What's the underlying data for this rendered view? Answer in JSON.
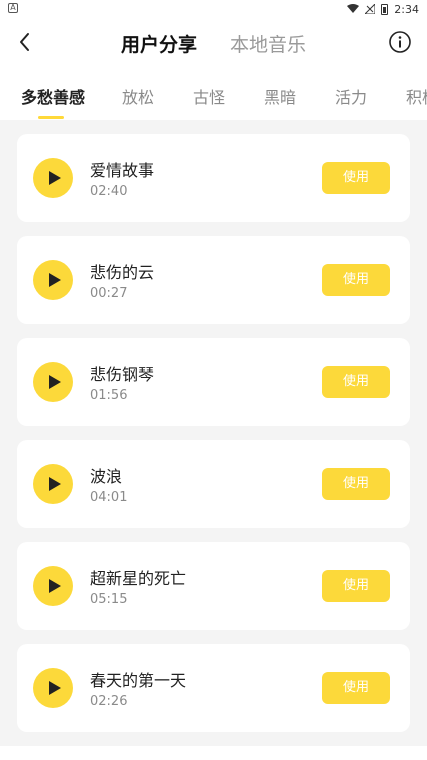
{
  "status": {
    "time": "2:34",
    "left_icon": "A"
  },
  "nav": {
    "tabs": [
      "用户分享",
      "本地音乐"
    ],
    "active_tab": 0
  },
  "categories": {
    "items": [
      "多愁善感",
      "放松",
      "古怪",
      "黑暗",
      "活力",
      "积极"
    ],
    "active": 0
  },
  "tracks": [
    {
      "title": "爱情故事",
      "duration": "02:40",
      "action": "使用"
    },
    {
      "title": "悲伤的云",
      "duration": "00:27",
      "action": "使用"
    },
    {
      "title": "悲伤钢琴",
      "duration": "01:56",
      "action": "使用"
    },
    {
      "title": "波浪",
      "duration": "04:01",
      "action": "使用"
    },
    {
      "title": "超新星的死亡",
      "duration": "05:15",
      "action": "使用"
    },
    {
      "title": "春天的第一天",
      "duration": "02:26",
      "action": "使用"
    }
  ],
  "colors": {
    "accent": "#fcd93a",
    "background": "#f4f4f4"
  }
}
